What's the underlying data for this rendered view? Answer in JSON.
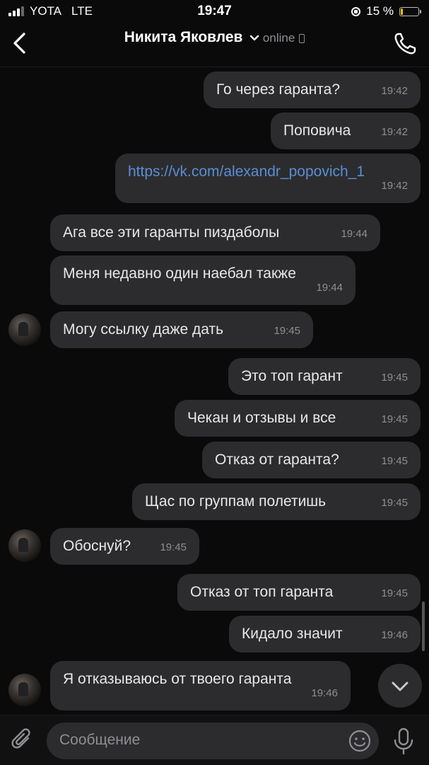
{
  "status_bar": {
    "carrier": "YOTA",
    "network": "LTE",
    "time": "19:47",
    "battery": "15 %",
    "battery_level": 0.15,
    "battery_color": "#f4c20d"
  },
  "header": {
    "contact_name": "Никита Яковлев",
    "status": "online",
    "icons": {
      "back": "chevron-left-icon",
      "expand": "chevron-down-icon",
      "device": "mobile-phone-icon",
      "call": "phone-icon"
    }
  },
  "messages": [
    {
      "from": "me",
      "text": "Го через гаранта?",
      "time": "19:42"
    },
    {
      "from": "me",
      "text": "Поповича",
      "time": "19:42"
    },
    {
      "from": "me",
      "text": "https://vk.com/alexandr_popovich_1",
      "time": "19:42",
      "link": true
    },
    {
      "from": "them",
      "text": "Ага все эти гаранты пиздаболы",
      "time": "19:44"
    },
    {
      "from": "them",
      "text": "Меня недавно один наебал также",
      "time": "19:44"
    },
    {
      "from": "them",
      "text": "Могу ссылку даже дать",
      "time": "19:45",
      "avatar": true
    },
    {
      "from": "me",
      "text": "Это топ гарант",
      "time": "19:45"
    },
    {
      "from": "me",
      "text": "Чекан и отзывы и все",
      "time": "19:45"
    },
    {
      "from": "me",
      "text": "Отказ от гаранта?",
      "time": "19:45"
    },
    {
      "from": "me",
      "text": "Щас по группам полетишь",
      "time": "19:45"
    },
    {
      "from": "them",
      "text": "Обоснуй?",
      "time": "19:45",
      "avatar": true
    },
    {
      "from": "me",
      "text": "Отказ от топ гаранта",
      "time": "19:45"
    },
    {
      "from": "me",
      "text": "Кидало значит",
      "time": "19:46"
    },
    {
      "from": "them",
      "text": "Я отказываюсь от твоего гаранта",
      "time": "19:46",
      "avatar": true
    }
  ],
  "composer": {
    "placeholder": "Сообщение",
    "icons": {
      "attach": "paperclip-icon",
      "emoji": "smiley-icon",
      "mic": "microphone-icon",
      "scroll_down": "chevron-down-icon"
    }
  },
  "colors": {
    "background": "#0a0a0a",
    "bubble": "#2c2c2e",
    "link": "#5a8ed3",
    "muted": "#8e8e93"
  }
}
